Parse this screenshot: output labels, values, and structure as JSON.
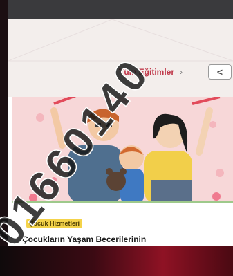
{
  "nav": {
    "all_trainings_label": "Tüm Eğitimler",
    "arrow_glyph": "›",
    "prev_glyph": "<"
  },
  "card": {
    "badge_label": "Çocuk Hizmetleri",
    "title": "Çocukların Yaşam Becerilerinin",
    "image_alt": "family-illustration"
  },
  "watermark": {
    "text": "01660140"
  },
  "colors": {
    "accent": "#c0394b",
    "badge": "#f4d34a",
    "hero_bg": "#f7d7d8"
  }
}
